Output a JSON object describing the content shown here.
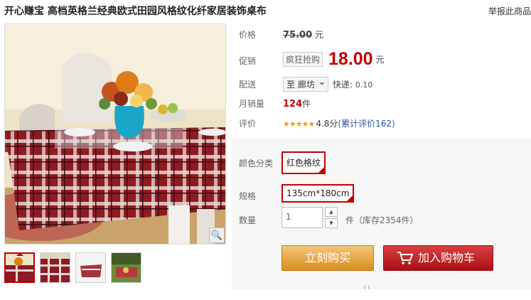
{
  "header": {
    "title": "开心赚宝 高档英格兰经典欧式田园风格纹化纤家居装饰桌布",
    "report_link": "举报此商品"
  },
  "gallery": {
    "main_alt": "table with red plaid tablecloth",
    "zoom_icon": "magnifier-icon",
    "thumbs": [
      "red-plaid-1",
      "red-plaid-2",
      "red-plaid-3",
      "red-plaid-4"
    ]
  },
  "price": {
    "label": "价格",
    "original": "75.00",
    "unit": "元"
  },
  "promo": {
    "label": "促销",
    "tag": "疯狂抢购",
    "price": "18.00",
    "unit": "元"
  },
  "shipping": {
    "label": "配送",
    "destination": "至 廊坊",
    "express_label": "快递:",
    "express_fee": "0.10"
  },
  "monthly_sales": {
    "label": "月销量",
    "count": "124",
    "unit": "件"
  },
  "rating": {
    "label": "评价",
    "stars": "★★★★★",
    "score": "4.8分",
    "reviews_link": "(累计评价162)",
    "star_color": "#f0a000"
  },
  "options": {
    "color_label": "颜色分类",
    "color_value": "红色格纹",
    "spec_label": "规格",
    "spec_value": "135cm*180cm",
    "qty_label": "数量",
    "qty_value": "1",
    "stock_text": "件（库存2354件）"
  },
  "actions": {
    "buy_now": "立刻购买",
    "add_to_cart": "加入购物车"
  },
  "colors": {
    "accent_red": "#c40000",
    "buy_orange": "#e39a2c",
    "link_blue": "#2953a6"
  }
}
